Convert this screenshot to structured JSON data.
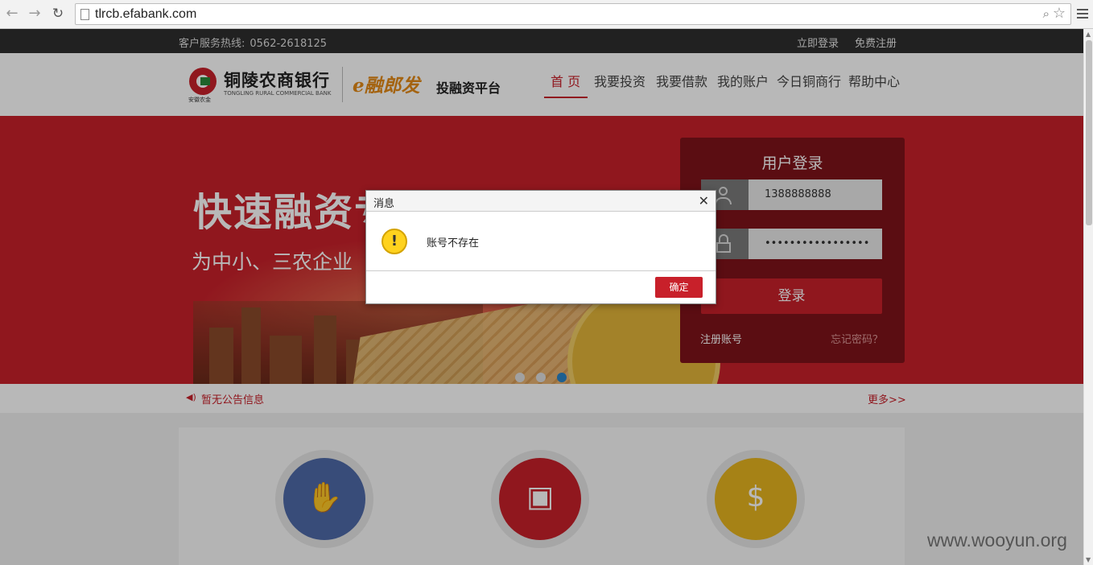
{
  "browser": {
    "url": "tlrcb.efabank.com",
    "back_icon": "←",
    "forward_icon": "→",
    "reload_icon": "↻"
  },
  "topbar": {
    "hotline_label": "客户服务热线:",
    "hotline_number": "0562-2618125",
    "login_link": "立即登录",
    "register_link": "免费注册"
  },
  "header": {
    "bank_name_cn": "铜陵农商银行",
    "bank_name_en": "TONGLING RURAL COMMERCIAL BANK",
    "emblem_caption": "安徽农金",
    "brand": "e融郎发",
    "platform": "投融资平台",
    "nav": [
      "首 页",
      "我要投资",
      "我要借款",
      "我的账户",
      "今日铜商行",
      "帮助中心"
    ],
    "active_nav": "首 页"
  },
  "banner": {
    "headline": "快速融资专业服务",
    "subline": "为中小、三农企业",
    "slides_count": 3,
    "active_slide": 3
  },
  "login": {
    "title": "用户登录",
    "username_value": "1388888888",
    "password_value": "•••••••••••••••••",
    "submit_label": "登录",
    "register_account": "注册账号",
    "forgot_password": "忘记密码？"
  },
  "notice": {
    "text": "暂无公告信息",
    "more": "更多>>"
  },
  "features": [
    {
      "icon": "coins-hand-icon",
      "color": "#4e6aa8",
      "glyph": "✋"
    },
    {
      "icon": "wallet-icon",
      "color": "#c8202a",
      "glyph": "▣"
    },
    {
      "icon": "shield-dollar-icon",
      "color": "#e6b51f",
      "glyph": "$"
    }
  ],
  "dialog": {
    "title": "消息",
    "message": "账号不存在",
    "ok_label": "确定",
    "close_icon": "✕"
  },
  "watermark": "www.wooyun.org",
  "colors": {
    "brand_red": "#c8202a",
    "login_panel": "#7e1219",
    "topbar": "#2e2e2e",
    "brand_orange": "#e38a17"
  }
}
